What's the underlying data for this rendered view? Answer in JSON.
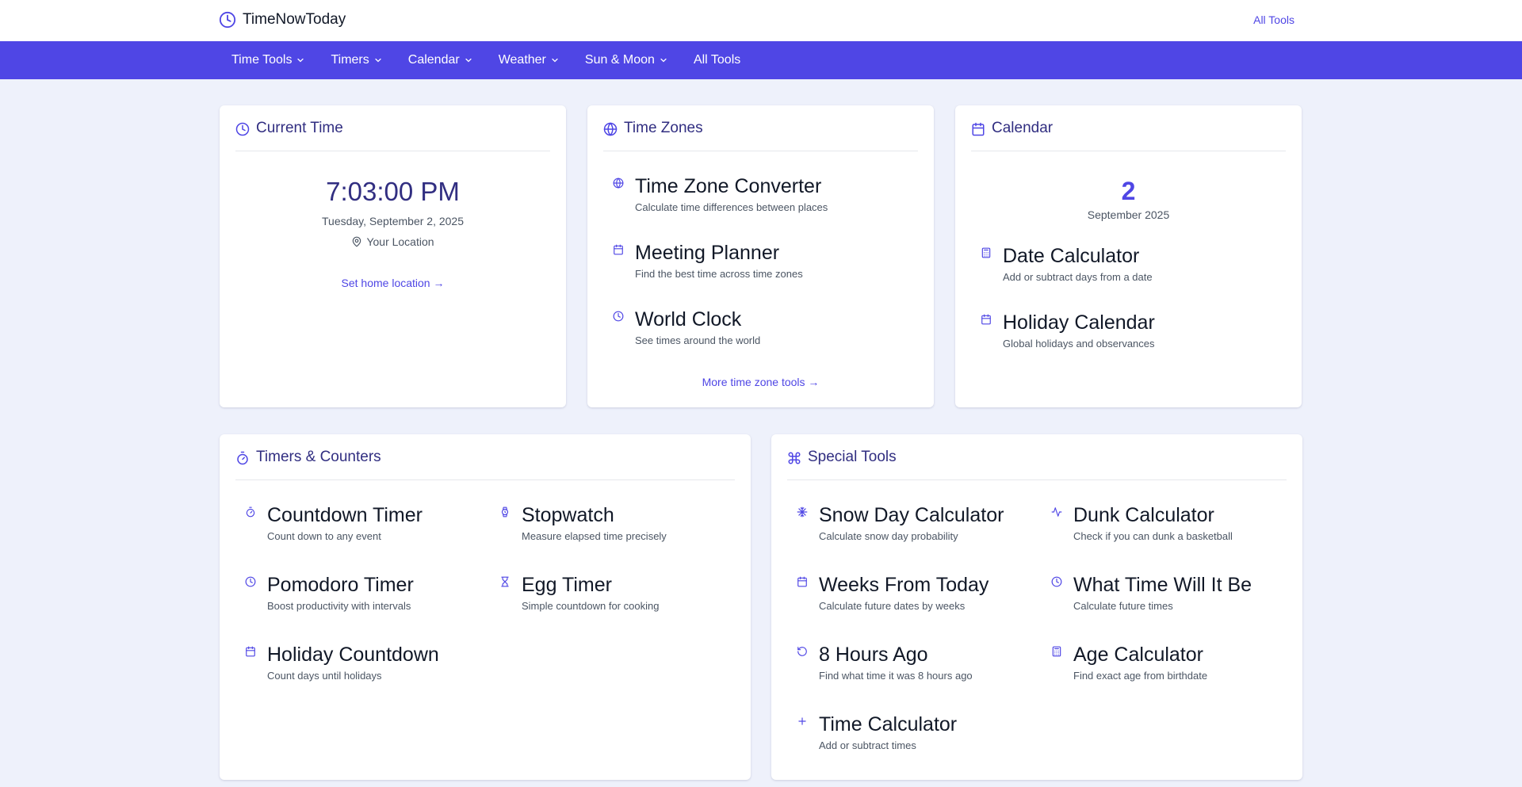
{
  "brand": {
    "name": "TimeNowToday",
    "icon": "clock-icon"
  },
  "top_link": "All Tools",
  "nav": [
    {
      "label": "Time Tools",
      "has_dropdown": true
    },
    {
      "label": "Timers",
      "has_dropdown": true
    },
    {
      "label": "Calendar",
      "has_dropdown": true
    },
    {
      "label": "Weather",
      "has_dropdown": true
    },
    {
      "label": "Sun & Moon",
      "has_dropdown": true
    },
    {
      "label": "All Tools",
      "has_dropdown": false
    }
  ],
  "current_time": {
    "title": "Current Time",
    "time": "7:03:00 PM",
    "date": "Tuesday, September 2, 2025",
    "location": "Your Location",
    "link": "Set home location →"
  },
  "time_zones": {
    "title": "Time Zones",
    "items": [
      {
        "title": "Time Zone Converter",
        "desc": "Calculate time differences between places",
        "icon": "globe-icon"
      },
      {
        "title": "Meeting Planner",
        "desc": "Find the best time across time zones",
        "icon": "calendar-icon"
      },
      {
        "title": "World Clock",
        "desc": "See times around the world",
        "icon": "clock-icon"
      }
    ],
    "link": "More time zone tools →"
  },
  "calendar": {
    "title": "Calendar",
    "day": "2",
    "month": "September 2025",
    "items": [
      {
        "title": "Date Calculator",
        "desc": "Add or subtract days from a date",
        "icon": "calculator-icon"
      },
      {
        "title": "Holiday Calendar",
        "desc": "Global holidays and observances",
        "icon": "calendar-icon"
      }
    ]
  },
  "timers": {
    "title": "Timers & Counters",
    "items": [
      {
        "title": "Countdown Timer",
        "desc": "Count down to any event",
        "icon": "timer-icon"
      },
      {
        "title": "Stopwatch",
        "desc": "Measure elapsed time precisely",
        "icon": "watch-icon"
      },
      {
        "title": "Pomodoro Timer",
        "desc": "Boost productivity with intervals",
        "icon": "clock-icon"
      },
      {
        "title": "Egg Timer",
        "desc": "Simple countdown for cooking",
        "icon": "hourglass-icon"
      },
      {
        "title": "Holiday Countdown",
        "desc": "Count days until holidays",
        "icon": "calendar-icon"
      }
    ]
  },
  "special": {
    "title": "Special Tools",
    "items": [
      {
        "title": "Snow Day Calculator",
        "desc": "Calculate snow day probability",
        "icon": "snowflake-icon"
      },
      {
        "title": "Dunk Calculator",
        "desc": "Check if you can dunk a basketball",
        "icon": "activity-icon"
      },
      {
        "title": "Weeks From Today",
        "desc": "Calculate future dates by weeks",
        "icon": "calendar-icon"
      },
      {
        "title": "What Time Will It Be",
        "desc": "Calculate future times",
        "icon": "clock-icon"
      },
      {
        "title": "8 Hours Ago",
        "desc": "Find what time it was 8 hours ago",
        "icon": "rotate-ccw-icon"
      },
      {
        "title": "Age Calculator",
        "desc": "Find exact age from birthdate",
        "icon": "calculator-icon"
      },
      {
        "title": "Time Calculator",
        "desc": "Add or subtract times",
        "icon": "plus-icon"
      }
    ]
  },
  "colors": {
    "accent": "#4f46e5",
    "heading": "#312e81",
    "background": "#eef1fb"
  }
}
